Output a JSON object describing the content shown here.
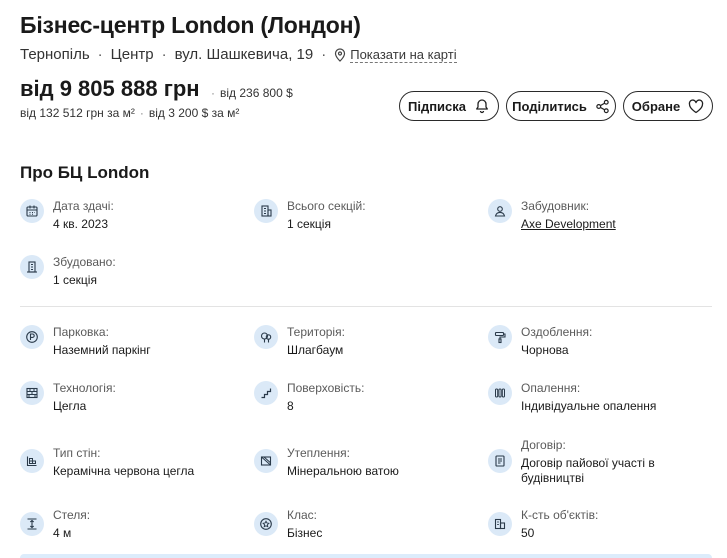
{
  "header": {
    "title": "Бізнес-центр London (Лондон)",
    "city": "Тернопіль",
    "district": "Центр",
    "street": "вул. Шашкевича, 19",
    "map_link": "Показати на карті"
  },
  "price": {
    "main": "від 9 805 888 грн",
    "usd": "від 236 800 $",
    "per_m2_uah": "від 132 512 грн за м²",
    "per_m2_usd": "від 3 200 $ за м²"
  },
  "actions": {
    "subscribe": "Підписка",
    "share": "Поділитись",
    "favorite": "Обране"
  },
  "about": {
    "title": "Про БЦ London",
    "delivery_label": "Дата здачі:",
    "delivery_value": "4 кв. 2023",
    "sections_label": "Всього секцій:",
    "sections_value": "1 секція",
    "developer_label": "Забудовник:",
    "developer_value": "Axe Development",
    "built_label": "Збудовано:",
    "built_value": "1 секція"
  },
  "specs": {
    "parking_label": "Парковка:",
    "parking_value": "Наземний паркінг",
    "territory_label": "Територія:",
    "territory_value": "Шлагбаум",
    "finishing_label": "Оздоблення:",
    "finishing_value": "Чорнова",
    "technology_label": "Технологія:",
    "technology_value": "Цегла",
    "floors_label": "Поверховість:",
    "floors_value": "8",
    "heating_label": "Опалення:",
    "heating_value": "Індивідуальне опалення",
    "walls_label": "Тип стін:",
    "walls_value": "Керамічна червона цегла",
    "insulation_label": "Утеплення:",
    "insulation_value": "Мінеральною ватою",
    "contract_label": "Договір:",
    "contract_value": "Договір пайової участі в будівництві",
    "ceiling_label": "Стеля:",
    "ceiling_value": "4 м",
    "class_label": "Клас:",
    "class_value": "Бізнес",
    "objects_label": "К-сть об'єктів:",
    "objects_value": "50"
  },
  "colors": {
    "icon_bg": "#dbe9f7",
    "icon_stroke": "#2a3a4a",
    "text": "#1a1a1a"
  }
}
